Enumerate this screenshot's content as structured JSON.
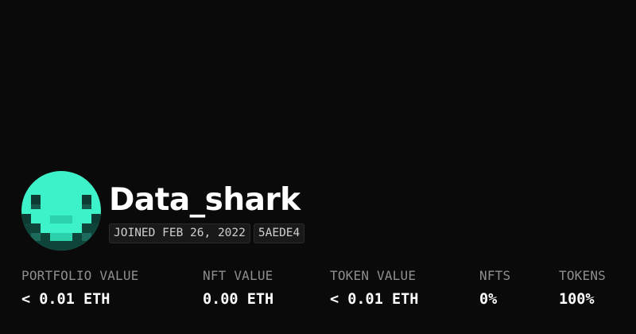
{
  "profile": {
    "username": "Data_shark",
    "joined": "JOINED FEB 26, 2022",
    "id_badge": "5AEDE4",
    "avatar_icon": "pixel-shark-avatar"
  },
  "colors": {
    "background": "#0b0a0a",
    "avatar_primary": "#3df2c8",
    "avatar_dark": "#0d3b33",
    "label": "#8e8e8e",
    "value": "#ffffff"
  },
  "stats": [
    {
      "label": "PORTFOLIO VALUE",
      "value": "< 0.01 ETH"
    },
    {
      "label": "NFT VALUE",
      "value": "0.00 ETH"
    },
    {
      "label": "TOKEN VALUE",
      "value": "< 0.01 ETH"
    },
    {
      "label": "NFTS",
      "value": "0%"
    },
    {
      "label": "TOKENS",
      "value": "100%"
    }
  ]
}
